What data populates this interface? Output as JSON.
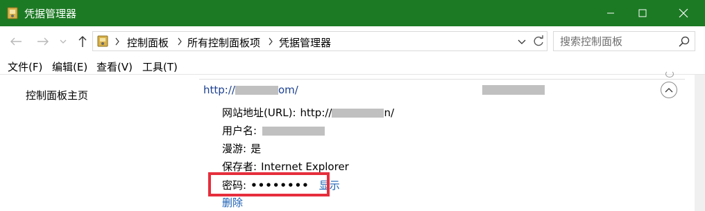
{
  "window": {
    "title": "凭据管理器"
  },
  "address": {
    "breadcrumbs": [
      "控制面板",
      "所有控制面板项",
      "凭据管理器"
    ]
  },
  "search": {
    "placeholder": "搜索控制面板"
  },
  "menu": [
    "文件(F)",
    "编辑(E)",
    "查看(V)",
    "工具(T)"
  ],
  "sidebar": {
    "home_link": "控制面板主页"
  },
  "credential": {
    "title_prefix": "http://",
    "title_suffix": "om/",
    "url_label": "网站地址(URL):",
    "url_prefix": "http://",
    "url_suffix": "n/",
    "username_label": "用户名:",
    "roaming_label": "漫游:",
    "roaming_value": "是",
    "saved_by_label": "保存者:",
    "saved_by_value": "Internet Explorer",
    "password_label": "密码:",
    "password_masked": "••••••••",
    "show_label": "显示",
    "delete_label": "删除"
  },
  "colors": {
    "titlebar": "#1c7a24",
    "link": "#1a5fb4",
    "highlight": "#e62e3c"
  },
  "icons": [
    "credential-manager-icon",
    "minimize-icon",
    "maximize-icon",
    "close-icon",
    "back-arrow-icon",
    "forward-arrow-icon",
    "recent-dropdown-icon",
    "up-arrow-icon",
    "chevron-right-icon",
    "chevron-down-icon",
    "refresh-icon",
    "search-icon",
    "collapse-chevron-up-icon"
  ]
}
